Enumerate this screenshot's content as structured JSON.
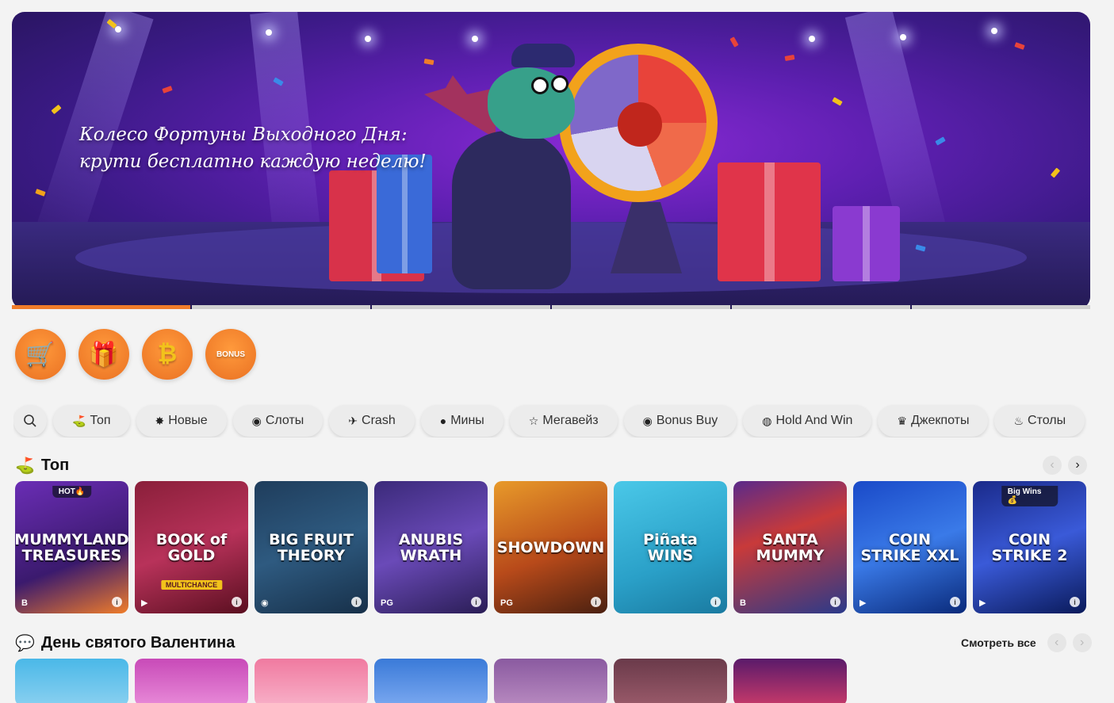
{
  "banner": {
    "line1": "Колесо Фортуны Выходного Дня:",
    "line2": "крути бесплатно каждую неделю!",
    "slides_total": 6,
    "active_slide": 1
  },
  "quick_links": [
    {
      "name": "treasure-cart-icon",
      "glyph": "🛒"
    },
    {
      "name": "refresh-gift-icon",
      "glyph": "🎁"
    },
    {
      "name": "bitcoin-icon",
      "glyph": "₿"
    },
    {
      "name": "bonus-icon",
      "glyph": "BONUS"
    }
  ],
  "filters": {
    "search_icon": "search-icon",
    "items": [
      {
        "icon": "⛳",
        "label": "Топ",
        "name": "top"
      },
      {
        "icon": "✸",
        "label": "Новые",
        "name": "new"
      },
      {
        "icon": "◉",
        "label": "Слоты",
        "name": "slots"
      },
      {
        "icon": "✈",
        "label": "Crash",
        "name": "crash"
      },
      {
        "icon": "●",
        "label": "Мины",
        "name": "mines"
      },
      {
        "icon": "☆",
        "label": "Мегавейз",
        "name": "megaways"
      },
      {
        "icon": "◉",
        "label": "Bonus Buy",
        "name": "bonus-buy"
      },
      {
        "icon": "◍",
        "label": "Hold And Win",
        "name": "hold-and-win"
      },
      {
        "icon": "♛",
        "label": "Джекпоты",
        "name": "jackpots"
      },
      {
        "icon": "♨",
        "label": "Столы",
        "name": "tables"
      }
    ]
  },
  "sections": {
    "top": {
      "title": "Топ",
      "games": [
        {
          "title": "MUMMYLAND TREASURES",
          "badge": "HOT🔥",
          "prov": "B",
          "bg": "linear-gradient(160deg,#6a2db5,#3b1a6e 60%,#f07d2a)"
        },
        {
          "title": "BOOK of GOLD",
          "sub": "MULTICHANCE",
          "badge": "",
          "prov": "▶",
          "bg": "linear-gradient(160deg,#8a1f3a,#b8325a 50%,#5a0f20)"
        },
        {
          "title": "BIG FRUIT THEORY",
          "badge": "",
          "prov": "◉",
          "bg": "linear-gradient(160deg,#1f3d5c,#2e5a80 50%,#173049)"
        },
        {
          "title": "ANUBIS WRATH",
          "badge": "",
          "prov": "PG",
          "bg": "linear-gradient(160deg,#3b2a7a,#6a4ab8 50%,#2a1d55)"
        },
        {
          "title": "SHOWDOWN",
          "badge": "",
          "prov": "PG",
          "bg": "linear-gradient(160deg,#e89a2a,#b84a1a 55%,#4a2010)"
        },
        {
          "title": "Piñata WINS",
          "badge": "",
          "prov": "",
          "bg": "linear-gradient(160deg,#4ac8e8,#2aa0c8 60%,#1a7aa0)"
        },
        {
          "title": "SANTA MUMMY",
          "badge": "",
          "prov": "B",
          "bg": "linear-gradient(160deg,#5a2a8a,#c83a3a 40%,#2a3a8a)"
        },
        {
          "title": "COIN STRIKE XXL",
          "badge": "",
          "prov": "▶",
          "bg": "linear-gradient(160deg,#1a4ac8,#3a7ae8 50%,#0a2a7a)"
        },
        {
          "title": "COIN STRIKE 2",
          "badge": "Big Wins 💰",
          "prov": "▶",
          "bg": "linear-gradient(160deg,#1a2a8a,#3a5ad8 50%,#0a1a5a)"
        }
      ]
    },
    "valentine": {
      "title": "День святого Валентина",
      "see_all": "Смотреть все",
      "games": [
        {
          "bg": "linear-gradient(180deg,#4ab8e8,#8ad0f0)"
        },
        {
          "bg": "linear-gradient(180deg,#c84ab8,#e88ad8)"
        },
        {
          "bg": "linear-gradient(180deg,#f07aa0,#f8b0c8)"
        },
        {
          "bg": "linear-gradient(180deg,#3a7ad8,#7aa8f0)"
        },
        {
          "bg": "linear-gradient(180deg,#8a5aa0,#b88ac0)"
        },
        {
          "bg": "linear-gradient(180deg,#6a3a4a,#9a5a6a)"
        },
        {
          "bg": "linear-gradient(180deg,#5a1a6a,#c83a6a)"
        }
      ]
    }
  },
  "colors": {
    "accent": "#f07d2a",
    "background": "#f3f3f3"
  }
}
